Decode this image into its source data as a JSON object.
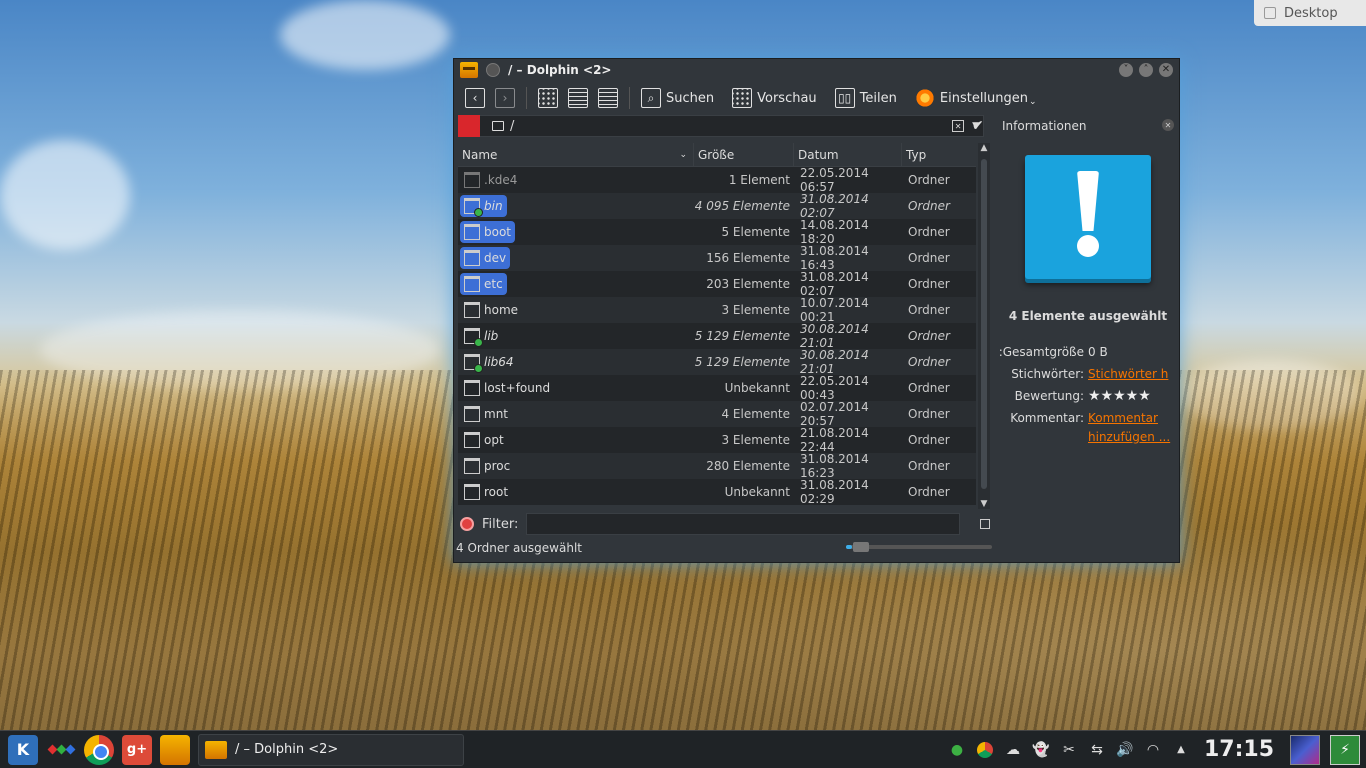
{
  "desktop_label": "Desktop",
  "window": {
    "title": "/ – Dolphin <2>"
  },
  "toolbar": {
    "search": "Suchen",
    "preview": "Vorschau",
    "share": "Teilen",
    "settings": "Einstellungen"
  },
  "location": {
    "path": "/"
  },
  "table": {
    "columns": {
      "name": "Name",
      "size": "Größe",
      "date": "Datum",
      "type": "Typ"
    },
    "rows": [
      {
        "name": ".kde4",
        "size": "1 Element",
        "date": "22.05.2014 06:57",
        "type": "Ordner"
      },
      {
        "name": "bin",
        "size": "4 095 Elemente",
        "date": "31.08.2014 02:07",
        "type": "Ordner"
      },
      {
        "name": "boot",
        "size": "5 Elemente",
        "date": "14.08.2014 18:20",
        "type": "Ordner"
      },
      {
        "name": "dev",
        "size": "156 Elemente",
        "date": "31.08.2014 16:43",
        "type": "Ordner"
      },
      {
        "name": "etc",
        "size": "203 Elemente",
        "date": "31.08.2014 02:07",
        "type": "Ordner"
      },
      {
        "name": "home",
        "size": "3 Elemente",
        "date": "10.07.2014 00:21",
        "type": "Ordner"
      },
      {
        "name": "lib",
        "size": "5 129 Elemente",
        "date": "30.08.2014 21:01",
        "type": "Ordner"
      },
      {
        "name": "lib64",
        "size": "5 129 Elemente",
        "date": "30.08.2014 21:01",
        "type": "Ordner"
      },
      {
        "name": "lost+found",
        "size": "Unbekannt",
        "date": "22.05.2014 00:43",
        "type": "Ordner"
      },
      {
        "name": "mnt",
        "size": "4 Elemente",
        "date": "02.07.2014 20:57",
        "type": "Ordner"
      },
      {
        "name": "opt",
        "size": "3 Elemente",
        "date": "21.08.2014 22:44",
        "type": "Ordner"
      },
      {
        "name": "proc",
        "size": "280 Elemente",
        "date": "31.08.2014 16:23",
        "type": "Ordner"
      },
      {
        "name": "root",
        "size": "Unbekannt",
        "date": "31.08.2014 02:29",
        "type": "Ordner"
      }
    ]
  },
  "filter": {
    "label": "Filter:",
    "value": ""
  },
  "status": {
    "text": "4 Ordner ausgewählt",
    "zoom_fraction": 0.05
  },
  "info": {
    "title": "Informationen",
    "selected": "4 Elemente ausgewählt",
    "total_size_label": "Gesamtgröße:",
    "total_size_value": "0 B",
    "tags_label": "Stichwörter:",
    "tags_link": "Stichwörter h",
    "rating_label": "Bewertung:",
    "rating_stars": "★★★★★",
    "comment_label": "Kommentar:",
    "comment_link_1": "Kommentar",
    "comment_link_2": "hinzufügen ..."
  },
  "taskbar": {
    "task_title": "/ – Dolphin <2>",
    "clock": "17:15"
  }
}
